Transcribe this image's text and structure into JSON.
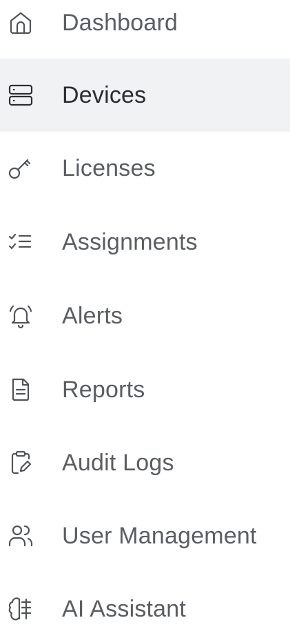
{
  "sidebar": {
    "accent_active_bg": "#f1f2f4",
    "items": [
      {
        "label": "Dashboard",
        "icon": "home-icon",
        "active": false
      },
      {
        "label": "Devices",
        "icon": "server-icon",
        "active": true
      },
      {
        "label": "Licenses",
        "icon": "key-icon",
        "active": false
      },
      {
        "label": "Assignments",
        "icon": "checklist-icon",
        "active": false
      },
      {
        "label": "Alerts",
        "icon": "bell-ringing-icon",
        "active": false
      },
      {
        "label": "Reports",
        "icon": "file-text-icon",
        "active": false
      },
      {
        "label": "Audit Logs",
        "icon": "clipboard-edit-icon",
        "active": false
      },
      {
        "label": "User Management",
        "icon": "users-icon",
        "active": false
      },
      {
        "label": "AI Assistant",
        "icon": "brain-icon",
        "active": false
      }
    ]
  }
}
